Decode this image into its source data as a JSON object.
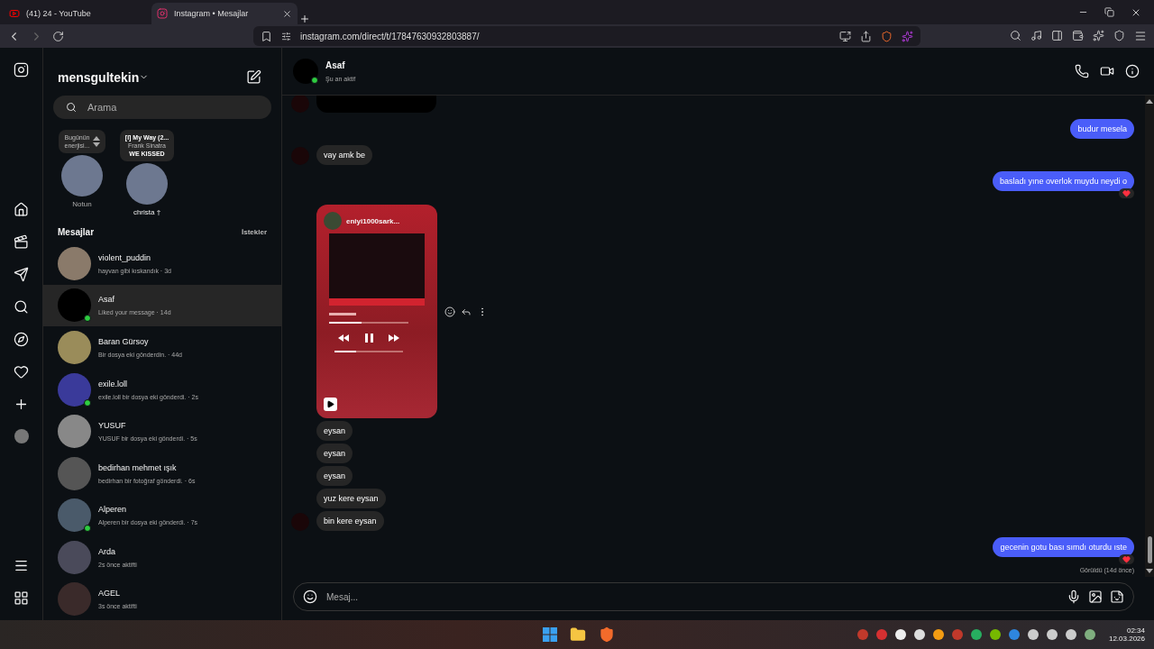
{
  "browser": {
    "tabs": [
      {
        "title": "(41) 24 - YouTube",
        "kind": "youtube",
        "selected": false
      },
      {
        "title": "Instagram • Mesajlar",
        "kind": "instagram",
        "selected": true
      }
    ],
    "url": "instagram.com/direct/t/17847630932803887/"
  },
  "inbox": {
    "username": "mensgultekin",
    "search_placeholder": "Arama",
    "notes": [
      {
        "bubble": [
          "Bugünün",
          "enerjisi..."
        ],
        "label": "Notun",
        "own": true
      },
      {
        "bubble": [
          "[I] My Way (2...",
          "Frank Sinatra",
          "WE KISSED"
        ],
        "label": "christa †",
        "own": false
      }
    ],
    "section_title": "Mesajlar",
    "requests_link": "İstekler",
    "conversations": [
      {
        "name": "violent_puddin",
        "preview": "hayvan gibi kıskandık · 3d",
        "online": false,
        "selected": false
      },
      {
        "name": "Asaf",
        "preview": "Liked your message · 14d",
        "online": true,
        "selected": true
      },
      {
        "name": "Baran Gürsoy",
        "preview": "Bir dosya eki gönderdin. · 44d",
        "online": false,
        "selected": false
      },
      {
        "name": "exile.loll",
        "preview": "exile.loll bir dosya eki gönderdi. · 2s",
        "online": true,
        "selected": false
      },
      {
        "name": "YUSUF",
        "preview": "YUSUF bir dosya eki gönderdi. · 5s",
        "online": false,
        "selected": false
      },
      {
        "name": "bedirhan mehmet ışık",
        "preview": "bedirhan bir fotoğraf gönderdi. · 6s",
        "online": false,
        "selected": false
      },
      {
        "name": "Alperen",
        "preview": "Alperen bir dosya eki gönderdi. · 7s",
        "online": true,
        "selected": false
      },
      {
        "name": "Arda",
        "preview": "2s önce aktifti",
        "online": false,
        "selected": false
      },
      {
        "name": "AGEL",
        "preview": "3s önce aktifti",
        "online": false,
        "selected": false
      }
    ]
  },
  "chat": {
    "name": "Asaf",
    "status": "Şu an aktif",
    "online": true,
    "messages": [
      {
        "kind": "media",
        "outgoing": false
      },
      {
        "kind": "text",
        "outgoing": true,
        "text": "budur mesela",
        "liked": false
      },
      {
        "kind": "text",
        "outgoing": false,
        "text": "vay amk be",
        "liked": false
      },
      {
        "kind": "text",
        "outgoing": true,
        "text": "basladı yıne overlok muydu neydi o",
        "liked": true
      },
      {
        "kind": "music",
        "outgoing": false,
        "account": "eniyi1000sark..."
      },
      {
        "kind": "text",
        "outgoing": false,
        "text": "eysan",
        "liked": false
      },
      {
        "kind": "text",
        "outgoing": false,
        "text": "eysan",
        "liked": false
      },
      {
        "kind": "text",
        "outgoing": false,
        "text": "eysan",
        "liked": false
      },
      {
        "kind": "text",
        "outgoing": false,
        "text": "yuz kere eysan",
        "liked": false
      },
      {
        "kind": "text",
        "outgoing": false,
        "text": "bin kere eysan",
        "liked": false
      },
      {
        "kind": "text",
        "outgoing": true,
        "text": "gecenin gotu bası sımdı oturdu ıste",
        "liked": true
      }
    ],
    "seen": "Görüldü (14d önce)",
    "composer_placeholder": "Mesaj..."
  },
  "taskbar": {
    "time": "02:34",
    "date": "12.03.2026"
  }
}
